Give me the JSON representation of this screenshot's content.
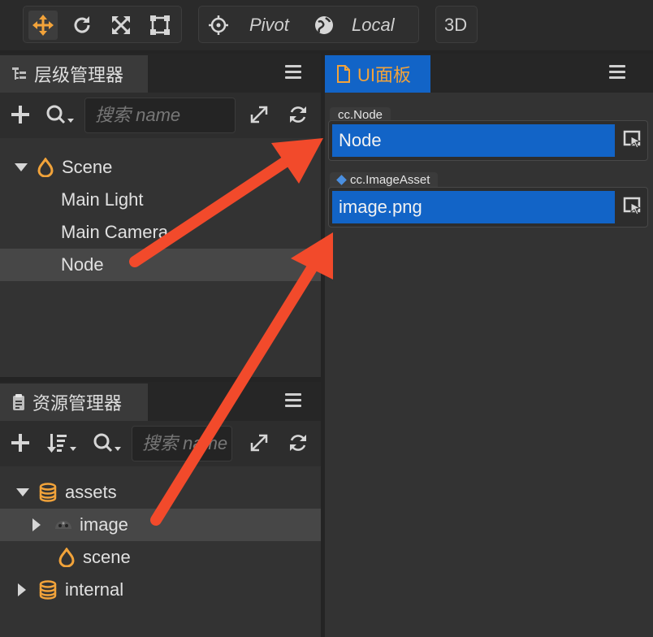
{
  "toolbar": {
    "tools": [
      "move-tool",
      "rotate-tool",
      "scale-tool",
      "rect-tool"
    ],
    "pivot_label": "Pivot",
    "local_label": "Local",
    "mode_3d_label": "3D"
  },
  "hierarchy_panel": {
    "title": "层级管理器",
    "search_placeholder": "搜索 name",
    "items": [
      {
        "label": "Scene",
        "depth": 0,
        "expanded": true,
        "icon": "scene-icon"
      },
      {
        "label": "Main Light",
        "depth": 1
      },
      {
        "label": "Main Camera",
        "depth": 1
      },
      {
        "label": "Node",
        "depth": 1,
        "selected": true
      }
    ]
  },
  "assets_panel": {
    "title": "资源管理器",
    "search_placeholder": "搜索 name",
    "items": [
      {
        "label": "assets",
        "depth": 0,
        "expanded": true,
        "icon": "database-icon"
      },
      {
        "label": "image",
        "depth": 1,
        "collapsed": true,
        "icon": "image-folder-icon",
        "selected": true
      },
      {
        "label": "scene",
        "depth": 1,
        "icon": "scene-icon"
      },
      {
        "label": "internal",
        "depth": 0,
        "collapsed": true,
        "icon": "database-icon"
      }
    ]
  },
  "ui_panel": {
    "title": "UI面板",
    "fields": [
      {
        "type_label": "cc.Node",
        "value": "Node"
      },
      {
        "type_label": "cc.ImageAsset",
        "value": "image.png"
      }
    ]
  },
  "colors": {
    "accent_orange": "#f2a33a",
    "field_blue": "#1264c7",
    "annotation_red": "#f24a2b"
  }
}
